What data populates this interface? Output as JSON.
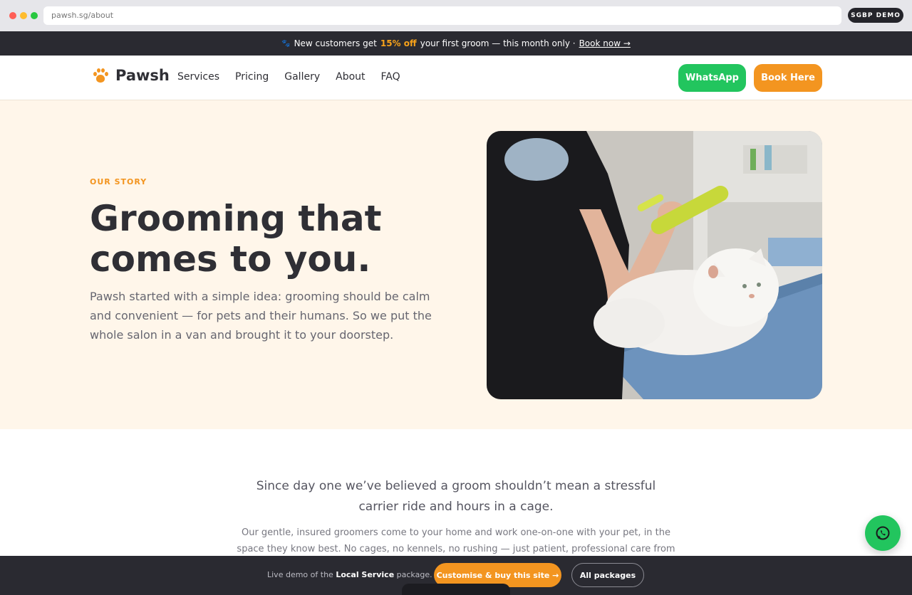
{
  "browser": {
    "url": "pawsh.sg/about",
    "badge": "SGBP DEMO"
  },
  "announcement": {
    "prefix": "New customers get",
    "highlight": "15% off",
    "middle": "your first groom — this month only ·",
    "link": "Book now →"
  },
  "header": {
    "brand": "Pawsh",
    "nav": [
      "Services",
      "Pricing",
      "Gallery",
      "About",
      "FAQ"
    ],
    "whatsapp_label": "WhatsApp",
    "book_label": "Book Here"
  },
  "hero": {
    "eyebrow": "OUR STORY",
    "title": "Grooming that comes to you.",
    "subtitle": "Pawsh started with a simple idea: grooming should be calm and convenient — for pets and their humans. So we put the whole salon in a van and brought it to your doorstep."
  },
  "story": {
    "lead": "Since day one we’ve believed a groom shouldn’t mean a stressful carrier ride and hours in a cage.",
    "body": "Our gentle, insured groomers come to your home and work one-on-one with your pet, in the space they know best. No cages, no kennels, no rushing — just patient, professional care from"
  },
  "demo_bar": {
    "text_prefix": "Live demo of the",
    "package": "Local Service",
    "text_suffix": "package.",
    "customise_label": "Customise & buy this site →",
    "packages_label": "All packages"
  },
  "colors": {
    "accent": "#f39520",
    "whatsapp": "#22c55e",
    "dark": "#2a2a31",
    "hero_bg": "#fff6ea"
  }
}
